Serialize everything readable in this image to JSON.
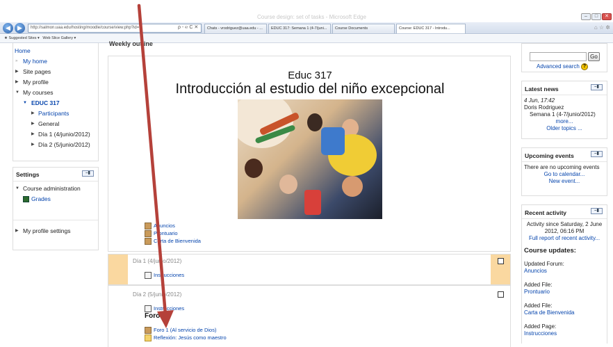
{
  "browser": {
    "window_title": "Course design: set of tasks - Microsoft Edge",
    "address": "http://salmon.uaa.edu/hosting/moodle/course/view.php?id=...",
    "address_controls": "ρ - ℮ C ✕",
    "tabs": [
      {
        "label": "Chats - vrodriguez@uaa.edu - ..."
      },
      {
        "label": "EDUC 317: Semana 1 (4-7/juni..."
      },
      {
        "label": "Course Documents"
      },
      {
        "label": "Course: EDUC 317 - Introdu...",
        "active": true
      }
    ],
    "favorites": [
      "Suggested Sites ▾",
      "Web Slice Gallery ▾"
    ],
    "right_icons": "⌂ ☆ ✲"
  },
  "nav": {
    "items": [
      {
        "label": "Home",
        "indent": 0
      },
      {
        "label": "My home",
        "indent": 1,
        "bullet": "»"
      },
      {
        "label": "Site pages",
        "indent": 1,
        "bullet": "▶"
      },
      {
        "label": "My profile",
        "indent": 1,
        "bullet": "▶"
      },
      {
        "label": "My courses",
        "indent": 1,
        "bullet": "▼"
      },
      {
        "label": "EDUC 317",
        "indent": 2,
        "bullet": "▼",
        "bold": true
      },
      {
        "label": "Participants",
        "indent": 3,
        "bullet": "▶"
      },
      {
        "label": "General",
        "indent": 3,
        "bullet": "▶"
      },
      {
        "label": "Día 1 (4/junio/2012)",
        "indent": 3,
        "bullet": "▶"
      },
      {
        "label": "Día 2 (5/junio/2012)",
        "indent": 3,
        "bullet": "▶"
      }
    ]
  },
  "settings": {
    "title": "Settings",
    "course_admin": "Course administration",
    "grades": "Grades",
    "profile_settings": "My profile settings"
  },
  "center": {
    "weekly_outline": "Weekly outline",
    "course_code": "Educ 317",
    "course_name": "Introducción al estudio del niño excepcional",
    "resources": [
      "Anuncios",
      "Prontuario",
      "Carta de Bienvenida"
    ],
    "day1": {
      "date": "Día 1 (4/junio/2012)",
      "items": [
        "Instrucciones"
      ]
    },
    "day2": {
      "date": "Día 2 (5/junio/2012)",
      "items": [
        "Instrucciones"
      ],
      "heading": "Foro",
      "forum": "Foro 1 (Al servicio de Dios)",
      "reflection": "Reflexión: Jesús como maestro"
    }
  },
  "search": {
    "go": "Go",
    "advanced": "Advanced search",
    "help": "?"
  },
  "latest_news": {
    "title": "Latest news",
    "date": "4 Jun, 17:42",
    "author": "Doris Rodriguez",
    "subject": "Semana 1 (4-7/junio/2012)",
    "more": "more...",
    "older": "Older topics ..."
  },
  "upcoming": {
    "title": "Upcoming events",
    "text": "There are no upcoming events",
    "calendar": "Go to calendar...",
    "new_event": "New event..."
  },
  "recent": {
    "title": "Recent activity",
    "since": "Activity since Saturday, 2 June 2012, 06:16 PM",
    "full_report": "Full report of recent activity...",
    "updates_title": "Course updates:",
    "updates": [
      {
        "kind": "Updated Forum:",
        "link": "Anuncios"
      },
      {
        "kind": "Added File:",
        "link": "Prontuario"
      },
      {
        "kind": "Added File:",
        "link": "Carta de Bienvenida"
      },
      {
        "kind": "Added Page:",
        "link": "Instrucciones"
      }
    ]
  },
  "colors": {
    "link": "#0645ad",
    "annotation_arrow": "#b5413a",
    "section_highlight": "#fad8a0"
  }
}
